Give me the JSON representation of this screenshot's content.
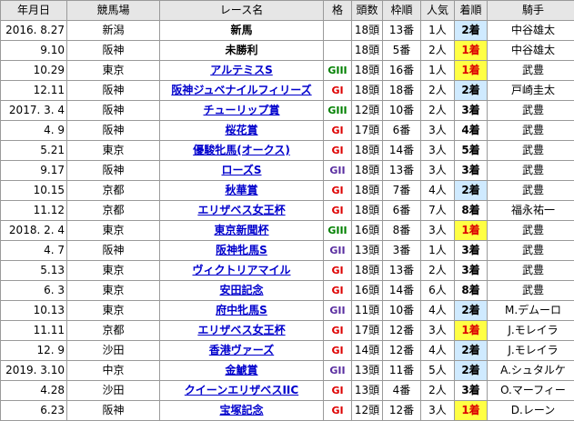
{
  "headers": [
    "年月日",
    "競馬場",
    "レース名",
    "格",
    "頭数",
    "枠順",
    "人気",
    "着順",
    "騎手"
  ],
  "rows": [
    {
      "date": "2016. 8.27",
      "venue": "新潟",
      "race": "新馬",
      "link": false,
      "grade": "",
      "gclass": "",
      "runners": "18頭",
      "gate": "13番",
      "pop": "1人",
      "finish": "2着",
      "fclass": "place2",
      "jockey": "中谷雄太"
    },
    {
      "date": "9.10",
      "venue": "阪神",
      "race": "未勝利",
      "link": false,
      "grade": "",
      "gclass": "",
      "runners": "18頭",
      "gate": "5番",
      "pop": "2人",
      "finish": "1着",
      "fclass": "win",
      "jockey": "中谷雄太"
    },
    {
      "date": "10.29",
      "venue": "東京",
      "race": "アルテミスS",
      "link": true,
      "grade": "GIII",
      "gclass": "g3",
      "runners": "18頭",
      "gate": "16番",
      "pop": "1人",
      "finish": "1着",
      "fclass": "win",
      "jockey": "武豊"
    },
    {
      "date": "12.11",
      "venue": "阪神",
      "race": "阪神ジュベナイルフィリーズ",
      "link": true,
      "grade": "GI",
      "gclass": "g1",
      "runners": "18頭",
      "gate": "18番",
      "pop": "2人",
      "finish": "2着",
      "fclass": "place2",
      "jockey": "戸崎圭太"
    },
    {
      "date": "2017. 3. 4",
      "venue": "阪神",
      "race": "チューリップ賞",
      "link": true,
      "grade": "GIII",
      "gclass": "g3",
      "runners": "12頭",
      "gate": "10番",
      "pop": "2人",
      "finish": "3着",
      "fclass": "place3",
      "jockey": "武豊"
    },
    {
      "date": "4. 9",
      "venue": "阪神",
      "race": "桜花賞",
      "link": true,
      "grade": "GI",
      "gclass": "g1",
      "runners": "17頭",
      "gate": "6番",
      "pop": "3人",
      "finish": "4着",
      "fclass": "",
      "jockey": "武豊"
    },
    {
      "date": "5.21",
      "venue": "東京",
      "race": "優駿牝馬(オークス)",
      "link": true,
      "grade": "GI",
      "gclass": "g1",
      "runners": "18頭",
      "gate": "14番",
      "pop": "3人",
      "finish": "5着",
      "fclass": "",
      "jockey": "武豊"
    },
    {
      "date": "9.17",
      "venue": "阪神",
      "race": "ローズS",
      "link": true,
      "grade": "GII",
      "gclass": "g2",
      "runners": "18頭",
      "gate": "13番",
      "pop": "3人",
      "finish": "3着",
      "fclass": "place3",
      "jockey": "武豊"
    },
    {
      "date": "10.15",
      "venue": "京都",
      "race": "秋華賞",
      "link": true,
      "grade": "GI",
      "gclass": "g1",
      "runners": "18頭",
      "gate": "7番",
      "pop": "4人",
      "finish": "2着",
      "fclass": "place2",
      "jockey": "武豊"
    },
    {
      "date": "11.12",
      "venue": "京都",
      "race": "エリザベス女王杯",
      "link": true,
      "grade": "GI",
      "gclass": "g1",
      "runners": "18頭",
      "gate": "6番",
      "pop": "7人",
      "finish": "8着",
      "fclass": "",
      "jockey": "福永祐一"
    },
    {
      "date": "2018. 2. 4",
      "venue": "東京",
      "race": "東京新聞杯",
      "link": true,
      "grade": "GIII",
      "gclass": "g3",
      "runners": "16頭",
      "gate": "8番",
      "pop": "3人",
      "finish": "1着",
      "fclass": "win",
      "jockey": "武豊"
    },
    {
      "date": "4. 7",
      "venue": "阪神",
      "race": "阪神牝馬S",
      "link": true,
      "grade": "GII",
      "gclass": "g2",
      "runners": "13頭",
      "gate": "3番",
      "pop": "1人",
      "finish": "3着",
      "fclass": "place3",
      "jockey": "武豊"
    },
    {
      "date": "5.13",
      "venue": "東京",
      "race": "ヴィクトリアマイル",
      "link": true,
      "grade": "GI",
      "gclass": "g1",
      "runners": "18頭",
      "gate": "13番",
      "pop": "2人",
      "finish": "3着",
      "fclass": "place3",
      "jockey": "武豊"
    },
    {
      "date": "6. 3",
      "venue": "東京",
      "race": "安田記念",
      "link": true,
      "grade": "GI",
      "gclass": "g1",
      "runners": "16頭",
      "gate": "14番",
      "pop": "6人",
      "finish": "8着",
      "fclass": "",
      "jockey": "武豊"
    },
    {
      "date": "10.13",
      "venue": "東京",
      "race": "府中牝馬S",
      "link": true,
      "grade": "GII",
      "gclass": "g2",
      "runners": "11頭",
      "gate": "10番",
      "pop": "4人",
      "finish": "2着",
      "fclass": "place2",
      "jockey": "M.デムーロ"
    },
    {
      "date": "11.11",
      "venue": "京都",
      "race": "エリザベス女王杯",
      "link": true,
      "grade": "GI",
      "gclass": "g1",
      "runners": "17頭",
      "gate": "12番",
      "pop": "3人",
      "finish": "1着",
      "fclass": "win",
      "jockey": "J.モレイラ"
    },
    {
      "date": "12. 9",
      "venue": "沙田",
      "race": "香港ヴァーズ",
      "link": true,
      "grade": "GI",
      "gclass": "g1",
      "runners": "14頭",
      "gate": "12番",
      "pop": "4人",
      "finish": "2着",
      "fclass": "place2",
      "jockey": "J.モレイラ"
    },
    {
      "date": "2019. 3.10",
      "venue": "中京",
      "race": "金鯱賞",
      "link": true,
      "grade": "GII",
      "gclass": "g2",
      "runners": "13頭",
      "gate": "11番",
      "pop": "5人",
      "finish": "2着",
      "fclass": "place2",
      "jockey": "A.シュタルケ"
    },
    {
      "date": "4.28",
      "venue": "沙田",
      "race": "クイーンエリザベスIIC",
      "link": true,
      "grade": "GI",
      "gclass": "g1",
      "runners": "13頭",
      "gate": "4番",
      "pop": "2人",
      "finish": "3着",
      "fclass": "place3",
      "jockey": "O.マーフィー"
    },
    {
      "date": "6.23",
      "venue": "阪神",
      "race": "宝塚記念",
      "link": true,
      "grade": "GI",
      "gclass": "g1",
      "runners": "12頭",
      "gate": "12番",
      "pop": "3人",
      "finish": "1着",
      "fclass": "win",
      "jockey": "D.レーン"
    }
  ]
}
